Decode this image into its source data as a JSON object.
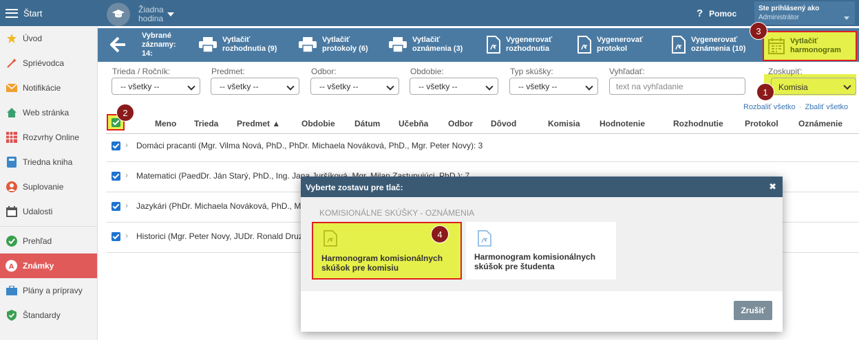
{
  "header": {
    "menu_label": "Štart",
    "lesson_line1": "Žiadna",
    "lesson_line2": "hodina",
    "help_label": "Pomoc",
    "user_line1": "Ste prihlásený ako",
    "user_line2": "Administrátor"
  },
  "sidebar": {
    "items": [
      {
        "label": "Úvod",
        "icon": "star-icon"
      },
      {
        "label": "Spriévodca",
        "icon": "wand-icon"
      },
      {
        "label": "Notifikácie",
        "icon": "envelope-icon"
      },
      {
        "label": "Web stránka",
        "icon": "house-icon"
      },
      {
        "label": "Rozvrhy Online",
        "icon": "calendar-grid-icon"
      },
      {
        "label": "Triedna kniha",
        "icon": "book-icon"
      },
      {
        "label": "Suplovanie",
        "icon": "person-icon"
      },
      {
        "label": "Udalosti",
        "icon": "calendar-icon"
      },
      {
        "label": "Prehľad",
        "icon": "check-circle-icon"
      },
      {
        "label": "Známky",
        "icon": "grade-icon"
      },
      {
        "label": "Plány a prípravy",
        "icon": "briefcase-icon"
      },
      {
        "label": "Štandardy",
        "icon": "shield-icon"
      }
    ],
    "active": "Známky"
  },
  "toolbar": {
    "selected_line1": "Vybrané",
    "selected_line2": "záznamy:",
    "selected_count": "14:",
    "buttons": [
      {
        "l1": "Vytlačiť",
        "l2": "rozhodnutia (9)"
      },
      {
        "l1": "Vytlačiť",
        "l2": "protokoly (6)"
      },
      {
        "l1": "Vytlačiť",
        "l2": "oznámenia (3)"
      },
      {
        "l1": "Vygenerovať",
        "l2": "rozhodnutia"
      },
      {
        "l1": "Vygenerovať",
        "l2": "protokol"
      },
      {
        "l1": "Vygenerovať",
        "l2": "oznámenia (10)"
      }
    ],
    "harmonogram": {
      "l1": "Vytlačiť",
      "l2": "harmonogram"
    }
  },
  "filters": {
    "trieda": {
      "label": "Trieda / Ročník:",
      "value": "-- všetky --"
    },
    "predmet": {
      "label": "Predmet:",
      "value": "-- všetky --"
    },
    "odbor": {
      "label": "Odbor:",
      "value": "-- všetky --"
    },
    "obdobie": {
      "label": "Obdobie:",
      "value": "-- všetky --"
    },
    "typ": {
      "label": "Typ skúšky:",
      "value": "-- všetky --"
    },
    "search": {
      "label": "Vyhľadať:",
      "placeholder": "text na vyhľadanie"
    },
    "zoskupit": {
      "label": "Zoskupiť:",
      "value": "Komisia"
    }
  },
  "links": {
    "expand": "Rozbaliť všetko",
    "collapse": "Zbaliť všetko"
  },
  "table": {
    "columns": [
      "Meno",
      "Trieda",
      "Predmet ▲",
      "Obdobie",
      "Dátum",
      "Učebňa",
      "Odbor",
      "Dôvod",
      "Komisia",
      "Hodnotenie",
      "Rozhodnutie",
      "Protokol",
      "Oznámenie"
    ],
    "rows": [
      "Domáci pracanti (Mgr. Vilma Nová, PhD., PhDr. Michaela Nováková, PhD., Mgr. Peter Novy): 3",
      "Matematici (PaedDr. Ján Starý, PhD., Ing. Jana Juršíková, Mgr. Milan Zastupujúci, PhD.): 7",
      "Jazykári (PhDr. Michaela Nováková, PhD., M",
      "Historici (Mgr. Peter Novy, JUDr. Ronald Druz"
    ]
  },
  "badges": [
    "1",
    "2",
    "3",
    "4"
  ],
  "modal": {
    "title": "Vyberte zostavu pre tlač:",
    "close": "✖",
    "section": "KOMISIONÁLNE SKÚŠKY - OZNÁMENIA",
    "options": [
      {
        "l1": "Harmonogram komisionálnych",
        "l2": "skúšok pre komisiu"
      },
      {
        "l1": "Harmonogram komisionálnych",
        "l2": "skúšok pre študenta"
      }
    ],
    "cancel": "Zrušiť"
  },
  "colors": {
    "header": "#3c6a90",
    "toolbar": "#4a7aa2",
    "highlight": "#e6f04a",
    "marker": "#e02020",
    "badge": "#8b1a1a",
    "active": "#e05a5a"
  }
}
